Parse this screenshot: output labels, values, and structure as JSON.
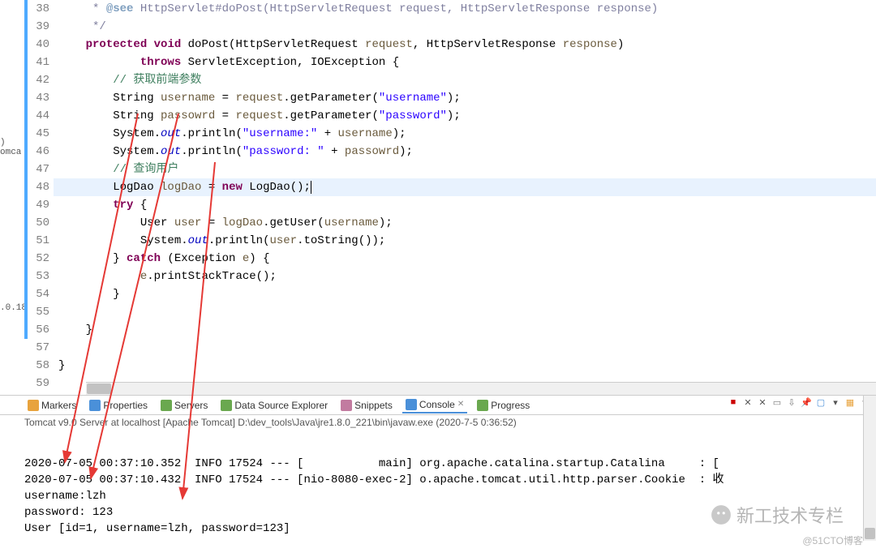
{
  "leftStub": {
    "line1": ")",
    "line2": "omca",
    "line3": ".0.18"
  },
  "code": {
    "lines": [
      {
        "n": 38,
        "mod": true,
        "html": [
          "jdoc:     * ",
          "jtag:@see",
          "jdoc: HttpServlet#doPost(HttpServletRequest request, HttpServletResponse response)"
        ]
      },
      {
        "n": 39,
        "mod": true,
        "html": [
          "jdoc:     */"
        ]
      },
      {
        "n": 40,
        "mod": true,
        "html": [
          "plain:    ",
          "kw:protected",
          "plain: ",
          "kw:void",
          "plain: doPost(HttpServletRequest ",
          "param:request",
          "plain:, HttpServletResponse ",
          "param:response",
          "plain:)"
        ]
      },
      {
        "n": 41,
        "mod": true,
        "html": [
          "plain:            ",
          "kw:throws",
          "plain: ServletException, IOException {"
        ]
      },
      {
        "n": 42,
        "mod": true,
        "html": [
          "plain:        ",
          "cm:// 获取前端参数"
        ]
      },
      {
        "n": 43,
        "mod": true,
        "html": [
          "plain:        String ",
          "param:username",
          "plain: = ",
          "param:request",
          "plain:.getParameter(",
          "str:\"username\"",
          "plain:);"
        ]
      },
      {
        "n": 44,
        "mod": true,
        "html": [
          "plain:        String ",
          "param:passowrd",
          "plain: = ",
          "param:request",
          "plain:.getParameter(",
          "str:\"password\"",
          "plain:);"
        ]
      },
      {
        "n": 45,
        "mod": true,
        "html": [
          "plain:        System.",
          "field:out",
          "plain:.println(",
          "str:\"username:\"",
          "plain: + ",
          "param:username",
          "plain:);"
        ]
      },
      {
        "n": 46,
        "mod": true,
        "html": [
          "plain:        System.",
          "field:out",
          "plain:.println(",
          "str:\"password: \"",
          "plain: + ",
          "param:passowrd",
          "plain:);"
        ]
      },
      {
        "n": 47,
        "mod": true,
        "html": [
          "plain:        ",
          "cm:// 查询用户"
        ]
      },
      {
        "n": 48,
        "mod": true,
        "hi": true,
        "html": [
          "plain:        LogDao ",
          "param:logDao",
          "plain: = ",
          "kw:new",
          "plain: LogDao();",
          "caret:"
        ]
      },
      {
        "n": 49,
        "mod": true,
        "html": [
          "plain:        ",
          "kw:try",
          "plain: {"
        ]
      },
      {
        "n": 50,
        "mod": true,
        "html": [
          "plain:            User ",
          "param:user",
          "plain: = ",
          "param:logDao",
          "plain:.getUser(",
          "param:username",
          "plain:);"
        ]
      },
      {
        "n": 51,
        "mod": true,
        "html": [
          "plain:            System.",
          "field:out",
          "plain:.println(",
          "param:user",
          "plain:.toString());"
        ]
      },
      {
        "n": 52,
        "mod": true,
        "html": [
          "plain:        } ",
          "kw:catch",
          "plain: (Exception ",
          "param:e",
          "plain:) {"
        ]
      },
      {
        "n": 53,
        "mod": true,
        "html": [
          "plain:            ",
          "param:e",
          "plain:.printStackTrace();"
        ]
      },
      {
        "n": 54,
        "mod": true,
        "html": [
          "plain:        }"
        ]
      },
      {
        "n": 55,
        "mod": true,
        "html": [
          "plain: "
        ]
      },
      {
        "n": 56,
        "mod": true,
        "html": [
          "plain:    }"
        ]
      },
      {
        "n": 57,
        "mod": false,
        "html": [
          "plain: "
        ]
      },
      {
        "n": 58,
        "mod": false,
        "html": [
          "plain:}"
        ]
      },
      {
        "n": 59,
        "mod": false,
        "html": [
          "plain: "
        ]
      }
    ]
  },
  "tabs": {
    "items": [
      {
        "label": "Markers"
      },
      {
        "label": "Properties"
      },
      {
        "label": "Servers"
      },
      {
        "label": "Data Source Explorer"
      },
      {
        "label": "Snippets"
      },
      {
        "label": "Console",
        "active": true
      },
      {
        "label": "Progress"
      }
    ]
  },
  "consoleHeader": "Tomcat v9.0 Server at localhost [Apache Tomcat] D:\\dev_tools\\Java\\jre1.8.0_221\\bin\\javaw.exe  (2020-7-5 0:36:52)",
  "console": [
    "2020-07-05 00:37:10.352  INFO 17524 --- [           main] org.apache.catalina.startup.Catalina     : [",
    "2020-07-05 00:37:10.432  INFO 17524 --- [nio-8080-exec-2] o.apache.tomcat.util.http.parser.Cookie  : 收",
    "username:lzh",
    "password: 123",
    "User [id=1, username=lzh, password=123]"
  ],
  "watermark1": "新工技术专栏",
  "watermark2": "@51CTO博客"
}
